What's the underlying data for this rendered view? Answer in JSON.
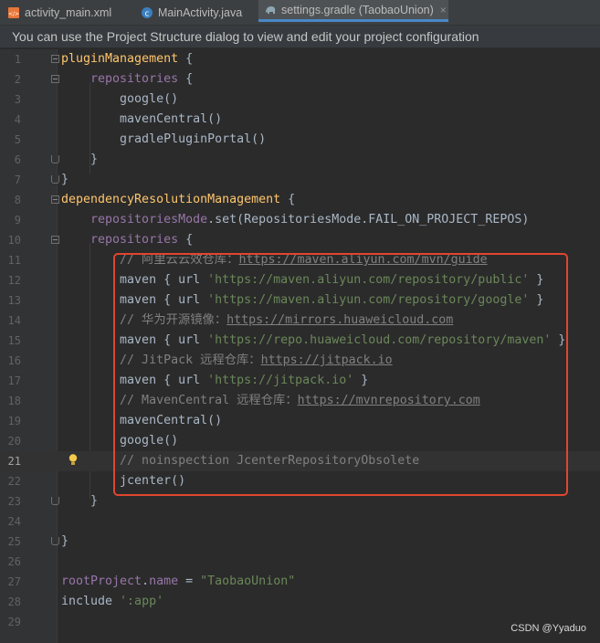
{
  "tabs": [
    {
      "label": "activity_main.xml",
      "icon": "xml-file-icon",
      "active": false
    },
    {
      "label": "MainActivity.java",
      "icon": "java-class-icon",
      "active": false
    },
    {
      "label": "settings.gradle (TaobaoUnion)",
      "icon": "gradle-elephant-icon",
      "active": true
    }
  ],
  "close_glyph": "×",
  "banner": "You can use the Project Structure dialog to view and edit your project configuration",
  "colors": {
    "editor_bg": "#2b2b2b",
    "keyword": "#cc7832",
    "function": "#ffc66d",
    "property": "#9876aa",
    "string": "#6a8759",
    "comment": "#808080",
    "highlight_box": "#e0462f"
  },
  "current_line": 21,
  "editor": {
    "lines": [
      {
        "n": "1",
        "fold": "start",
        "tokens": [
          {
            "t": "pluginManagement",
            "c": "fn"
          },
          {
            "t": " {",
            "c": "plain"
          }
        ]
      },
      {
        "n": "2",
        "fold": "start",
        "tokens": [
          {
            "t": "    repositories",
            "c": "prop"
          },
          {
            "t": " {",
            "c": "plain"
          }
        ]
      },
      {
        "n": "3",
        "tokens": [
          {
            "t": "        google()",
            "c": "plain"
          }
        ]
      },
      {
        "n": "4",
        "tokens": [
          {
            "t": "        mavenCentral()",
            "c": "plain"
          }
        ]
      },
      {
        "n": "5",
        "tokens": [
          {
            "t": "        gradlePluginPortal()",
            "c": "plain"
          }
        ]
      },
      {
        "n": "6",
        "fold": "end",
        "tokens": [
          {
            "t": "    }",
            "c": "plain"
          }
        ]
      },
      {
        "n": "7",
        "fold": "end",
        "tokens": [
          {
            "t": "}",
            "c": "plain"
          }
        ]
      },
      {
        "n": "8",
        "fold": "start",
        "tokens": [
          {
            "t": "dependencyResolutionManagement",
            "c": "fn"
          },
          {
            "t": " {",
            "c": "plain"
          }
        ]
      },
      {
        "n": "9",
        "tokens": [
          {
            "t": "    repositoriesMode",
            "c": "prop"
          },
          {
            "t": ".set(RepositoriesMode.FAIL_ON_PROJECT_REPOS)",
            "c": "plain"
          }
        ]
      },
      {
        "n": "10",
        "fold": "start",
        "tokens": [
          {
            "t": "    repositories",
            "c": "prop"
          },
          {
            "t": " {",
            "c": "plain"
          }
        ]
      },
      {
        "n": "11",
        "tokens": [
          {
            "t": "        // 阿里云云效仓库：",
            "c": "cm"
          },
          {
            "t": "https://maven.aliyun.com/mvn/guide",
            "c": "link"
          }
        ]
      },
      {
        "n": "12",
        "tokens": [
          {
            "t": "        maven { url ",
            "c": "plain"
          },
          {
            "t": "'https://maven.aliyun.com/repository/public'",
            "c": "str"
          },
          {
            "t": " }",
            "c": "plain"
          }
        ]
      },
      {
        "n": "13",
        "tokens": [
          {
            "t": "        maven { url ",
            "c": "plain"
          },
          {
            "t": "'https://maven.aliyun.com/repository/google'",
            "c": "str"
          },
          {
            "t": " }",
            "c": "plain"
          }
        ]
      },
      {
        "n": "14",
        "tokens": [
          {
            "t": "        // 华为开源镜像：",
            "c": "cm"
          },
          {
            "t": "https://mirrors.huaweicloud.com",
            "c": "link"
          }
        ]
      },
      {
        "n": "15",
        "tokens": [
          {
            "t": "        maven { url ",
            "c": "plain"
          },
          {
            "t": "'https://repo.huaweicloud.com/repository/maven'",
            "c": "str"
          },
          {
            "t": " }",
            "c": "plain"
          }
        ]
      },
      {
        "n": "16",
        "tokens": [
          {
            "t": "        // JitPack 远程仓库：",
            "c": "cm"
          },
          {
            "t": "https://jitpack.io",
            "c": "link"
          }
        ]
      },
      {
        "n": "17",
        "tokens": [
          {
            "t": "        maven { url ",
            "c": "plain"
          },
          {
            "t": "'https://jitpack.io'",
            "c": "str"
          },
          {
            "t": " }",
            "c": "plain"
          }
        ]
      },
      {
        "n": "18",
        "tokens": [
          {
            "t": "        // MavenCentral 远程仓库：",
            "c": "cm"
          },
          {
            "t": "https://mvnrepository.com",
            "c": "link"
          }
        ]
      },
      {
        "n": "19",
        "tokens": [
          {
            "t": "        mavenCentral()",
            "c": "plain"
          }
        ]
      },
      {
        "n": "20",
        "tokens": [
          {
            "t": "        google()",
            "c": "plain"
          }
        ]
      },
      {
        "n": "21",
        "bulb": true,
        "tokens": [
          {
            "t": "        // noinspection JcenterRepositoryObsolete",
            "c": "cm"
          }
        ]
      },
      {
        "n": "22",
        "tokens": [
          {
            "t": "        jcenter()",
            "c": "plain"
          }
        ]
      },
      {
        "n": "23",
        "fold": "end",
        "tokens": [
          {
            "t": "    }",
            "c": "plain"
          }
        ]
      },
      {
        "n": "24",
        "tokens": []
      },
      {
        "n": "25",
        "fold": "end",
        "tokens": [
          {
            "t": "}",
            "c": "plain"
          }
        ]
      },
      {
        "n": "26",
        "tokens": []
      },
      {
        "n": "27",
        "tokens": [
          {
            "t": "rootProject",
            "c": "prop"
          },
          {
            "t": ".",
            "c": "plain"
          },
          {
            "t": "name",
            "c": "prop"
          },
          {
            "t": " = ",
            "c": "plain"
          },
          {
            "t": "\"TaobaoUnion\"",
            "c": "str"
          }
        ]
      },
      {
        "n": "28",
        "tokens": [
          {
            "t": "include ",
            "c": "plain"
          },
          {
            "t": "':app'",
            "c": "str"
          }
        ]
      },
      {
        "n": "29",
        "tokens": []
      }
    ]
  },
  "watermark": "CSDN @Yyaduo"
}
